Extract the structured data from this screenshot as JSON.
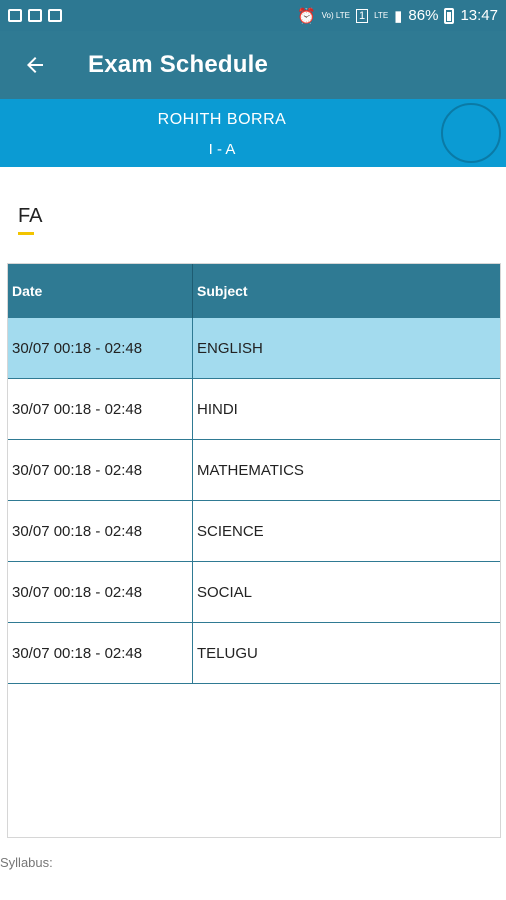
{
  "statusbar": {
    "battery_percent": "86%",
    "time": "13:47",
    "volte_label": "Vo) LTE",
    "lte_label": "LTE",
    "sim_label": "1"
  },
  "toolbar": {
    "title": "Exam Schedule",
    "back_icon": "arrow-left-icon"
  },
  "profile": {
    "name": "ROHITH  BORRA",
    "class": "I - A"
  },
  "exam_tab": {
    "label": "FA"
  },
  "table": {
    "headers": {
      "date": "Date",
      "subject": "Subject"
    },
    "rows": [
      {
        "date": "30/07 00:18 - 02:48",
        "subject": "ENGLISH",
        "selected": true
      },
      {
        "date": "30/07 00:18 - 02:48",
        "subject": "HINDI",
        "selected": false
      },
      {
        "date": "30/07 00:18 - 02:48",
        "subject": "MATHEMATICS",
        "selected": false
      },
      {
        "date": "30/07 00:18 - 02:48",
        "subject": "SCIENCE",
        "selected": false
      },
      {
        "date": "30/07 00:18 - 02:48",
        "subject": "SOCIAL",
        "selected": false
      },
      {
        "date": "30/07 00:18 - 02:48",
        "subject": "TELUGU",
        "selected": false
      }
    ]
  },
  "footer": {
    "syllabus_label": "Syllabus:"
  },
  "colors": {
    "header": "#2f7a93",
    "profile_bar": "#0b9bd3",
    "selected_row": "#a3dbee",
    "tab_indicator": "#f2c400"
  }
}
